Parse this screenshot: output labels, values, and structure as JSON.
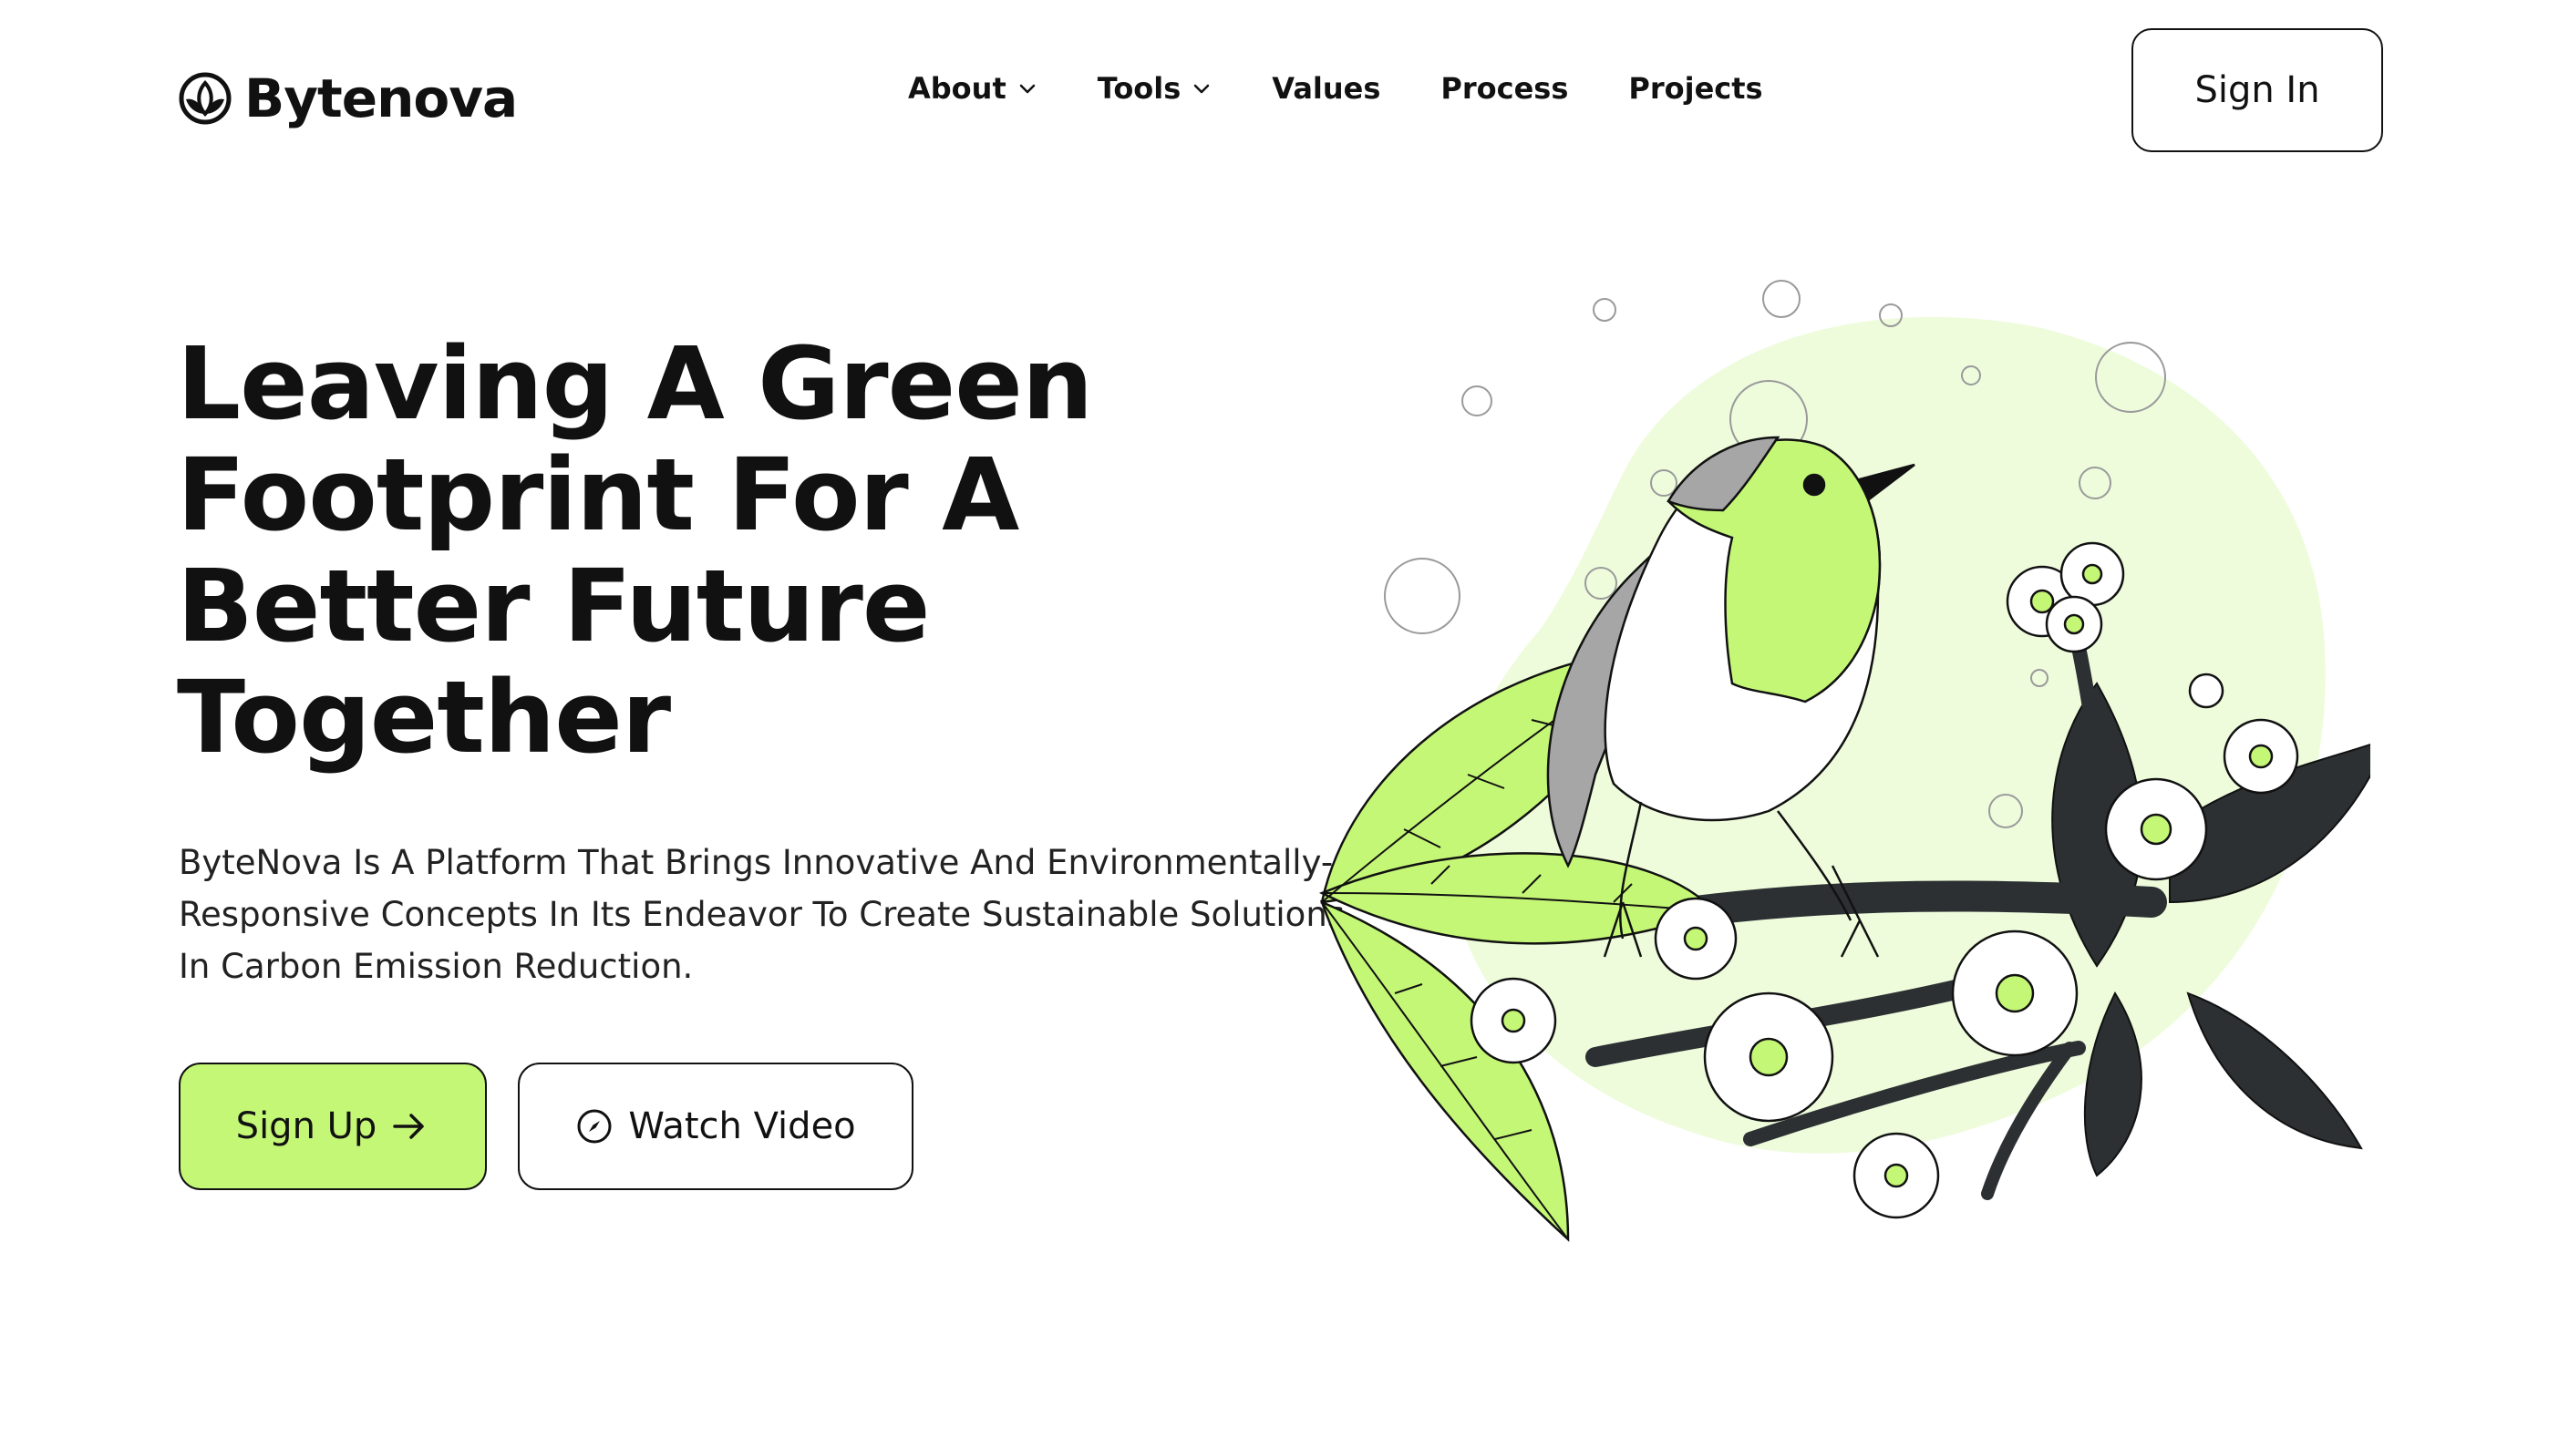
{
  "brand": {
    "name": "Bytenova",
    "accent": "#c5f777",
    "text_color": "#111111"
  },
  "nav": {
    "items": [
      {
        "label": "About",
        "has_dropdown": true
      },
      {
        "label": "Tools",
        "has_dropdown": true
      },
      {
        "label": "Values",
        "has_dropdown": false
      },
      {
        "label": "Process",
        "has_dropdown": false
      },
      {
        "label": "Projects",
        "has_dropdown": false
      }
    ],
    "signin_label": "Sign In"
  },
  "hero": {
    "title": "Leaving A Green Footprint For A Better Future Together",
    "description": "ByteNova Is A Platform That Brings Innovative And Environmentally-Responsive Concepts In Its Endeavor To Create Sustainable Solutions In Carbon Emission Reduction.",
    "signup_label": "Sign Up",
    "signup_icon": "arrow-right-icon",
    "watch_label": "Watch Video",
    "watch_icon": "compass-icon"
  },
  "illustration": {
    "subject": "bird-on-flowering-branch",
    "blob_color": "#eefcdc",
    "leaf_color": "#c5f777",
    "dark_leaf_color": "#2c3033"
  }
}
